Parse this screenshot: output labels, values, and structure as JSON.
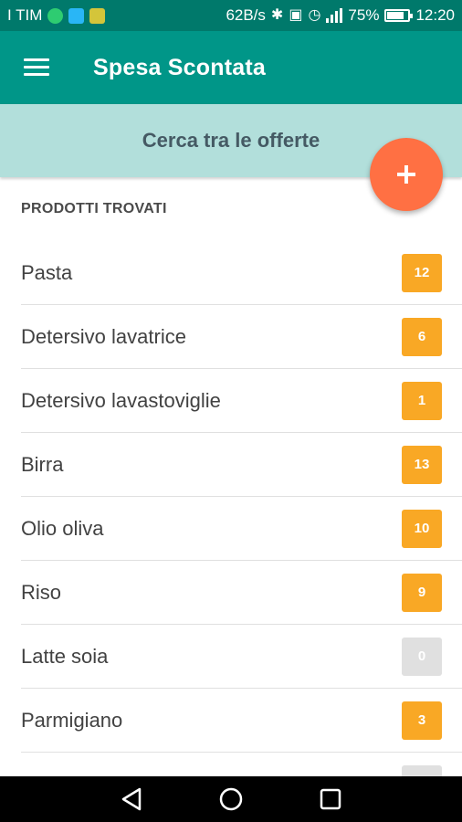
{
  "status_bar": {
    "carrier": "I TIM",
    "speed": "62B/s",
    "battery": "75%",
    "time": "12:20"
  },
  "app_bar": {
    "title": "Spesa Scontata"
  },
  "search_banner": {
    "label": "Cerca tra le offerte"
  },
  "section": {
    "header": "PRODOTTI TROVATI"
  },
  "products": [
    {
      "name": "Pasta",
      "count": "12"
    },
    {
      "name": "Detersivo lavatrice",
      "count": "6"
    },
    {
      "name": "Detersivo lavastoviglie",
      "count": "1"
    },
    {
      "name": "Birra",
      "count": "13"
    },
    {
      "name": "Olio oliva",
      "count": "10"
    },
    {
      "name": "Riso",
      "count": "9"
    },
    {
      "name": "Latte soia",
      "count": "0"
    },
    {
      "name": "Parmigiano",
      "count": "3"
    },
    {
      "name": "",
      "count": ""
    }
  ],
  "colors": {
    "status_bar": "#00796b",
    "app_bar": "#009688",
    "banner": "#b2dfdb",
    "fab": "#ff7043",
    "badge": "#f9a825",
    "badge_zero": "#e0e0e0"
  },
  "icons": {
    "menu": "hamburger-menu-icon",
    "fab": "plus-icon",
    "nav_back": "back-triangle-icon",
    "nav_home": "home-circle-icon",
    "nav_recents": "recents-square-icon"
  }
}
